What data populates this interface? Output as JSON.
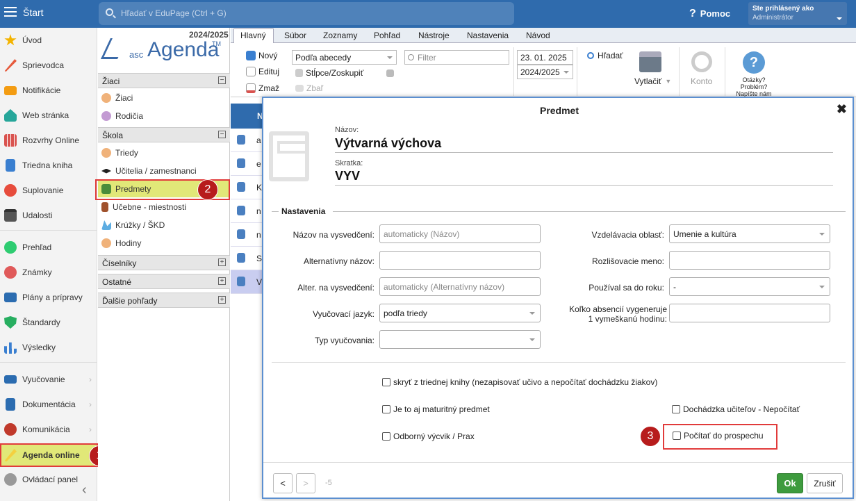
{
  "topbar": {
    "start": "Štart",
    "search_placeholder": "Hľadať v EduPage (Ctrl + G)",
    "help": "Pomoc",
    "user_line1": "Ste prihlásený ako",
    "user_line2": "Administrátor"
  },
  "sidebar": {
    "items": [
      "Úvod",
      "Sprievodca",
      "Notifikácie",
      "Web stránka",
      "Rozvrhy Online",
      "Triedna kniha",
      "Suplovanie",
      "Udalosti",
      "Prehľad",
      "Známky",
      "Plány a prípravy",
      "Štandardy",
      "Výsledky",
      "Vyučovanie",
      "Dokumentácia",
      "Komunikácia",
      "Agenda online",
      "Ovládací panel"
    ],
    "collapse": "‹"
  },
  "panel": {
    "year": "2024/2025",
    "logo_asc": "asc",
    "logo_agenda": "Agenda",
    "logo_tm": "TM",
    "groups": {
      "ziaci": "Žiaci",
      "skola": "Škola",
      "ciselniky": "Číselníky",
      "ostatne": "Ostatné",
      "dalsie": "Ďalšie pohľady"
    },
    "items": {
      "ziaci": "Žiaci",
      "rodicia": "Rodičia",
      "triedy": "Triedy",
      "ucitelia": "Učitelia / zamestnanci",
      "predmety": "Predmety",
      "ucebne": "Učebne - miestnosti",
      "kruzky": "Krúžky / ŠKD",
      "hodiny": "Hodiny"
    },
    "minus": "−",
    "plus": "+"
  },
  "badges": [
    "1",
    "2",
    "3"
  ],
  "ribbon": {
    "tabs": [
      "Hlavný",
      "Súbor",
      "Zoznamy",
      "Pohľad",
      "Nástroje",
      "Nastavenia",
      "Návod"
    ],
    "new": "Nový",
    "edit": "Edituj",
    "delete": "Zmaž",
    "sort": "Podľa abecedy",
    "filter_placeholder": "Filter",
    "columns": "Stĺpce/Zoskupiť",
    "collapse": "Zbaľ",
    "date": "23. 01. 2025",
    "year": "2024/2025",
    "find": "Hľadať",
    "print": "Vytlačiť",
    "account": "Konto",
    "help1": "Otázky?",
    "help2": "Problém?",
    "help3": "Napíšte nám"
  },
  "table": {
    "header": "N",
    "rows": [
      "a",
      "e",
      "K",
      "n",
      "n",
      "S",
      "V"
    ]
  },
  "modal": {
    "title": "Predmet",
    "name_label": "Názov:",
    "name": "Výtvarná výchova",
    "abbr_label": "Skratka:",
    "abbr": "VYV",
    "section": "Nastavenia",
    "l_cert_name": "Názov na vysvedčení:",
    "ph_cert_name": "automaticky (Názov)",
    "l_alt": "Alternatívny názov:",
    "l_alt_cert": "Alter. na vysvedčení:",
    "ph_alt_cert": "automaticky (Alternatívny názov)",
    "l_lang": "Vyučovací jazyk:",
    "v_lang": "podľa triedy",
    "l_type": "Typ vyučovania:",
    "l_area": "Vzdelávacia oblasť:",
    "v_area": "Umenie a kultúra",
    "l_distinct": "Rozlišovacie meno:",
    "l_used": "Používal sa do roku:",
    "v_used": "-",
    "l_abs1": "Koľko absencií vygeneruje",
    "l_abs2": "1 vymeškanú hodinu:",
    "c_hide": "skryť z triednej knihy (nezapisovať učivo a nepočítať dochádzku žiakov)",
    "c_matura": "Je to aj maturitný predmet",
    "c_teacher": "Dochádzka učiteľov - Nepočítať",
    "c_vocational": "Odborný výcvik / Prax",
    "c_grade": "Počítať do prospechu",
    "prev": "<",
    "next": ">",
    "page": "-5",
    "ok": "Ok",
    "cancel": "Zrušiť"
  }
}
